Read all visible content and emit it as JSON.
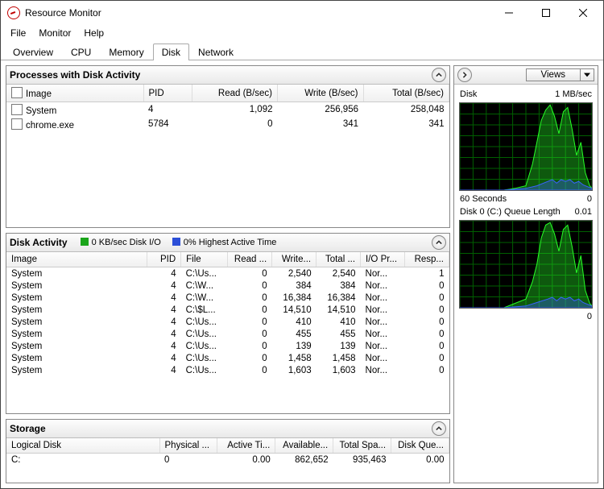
{
  "window": {
    "title": "Resource Monitor"
  },
  "menu": {
    "file": "File",
    "monitor": "Monitor",
    "help": "Help"
  },
  "tabs": {
    "items": [
      {
        "label": "Overview"
      },
      {
        "label": "CPU"
      },
      {
        "label": "Memory"
      },
      {
        "label": "Disk"
      },
      {
        "label": "Network"
      }
    ],
    "active": 3
  },
  "panels": {
    "processes": {
      "title": "Processes with Disk Activity",
      "cols": {
        "image": "Image",
        "pid": "PID",
        "read": "Read (B/sec)",
        "write": "Write (B/sec)",
        "total": "Total (B/sec)"
      },
      "rows": [
        {
          "image": "System",
          "pid": "4",
          "read": "1,092",
          "write": "256,956",
          "total": "258,048"
        },
        {
          "image": "chrome.exe",
          "pid": "5784",
          "read": "0",
          "write": "341",
          "total": "341"
        }
      ]
    },
    "activity": {
      "title": "Disk Activity",
      "meta1_label": "0 KB/sec Disk I/O",
      "meta2_label": "0% Highest Active Time",
      "cols": {
        "image": "Image",
        "pid": "PID",
        "file": "File",
        "read": "Read ...",
        "write": "Write...",
        "total": "Total ...",
        "prio": "I/O Pr...",
        "resp": "Resp..."
      },
      "rows": [
        {
          "image": "System",
          "pid": "4",
          "file": "C:\\Us...",
          "read": "0",
          "write": "2,540",
          "total": "2,540",
          "prio": "Nor...",
          "resp": "1"
        },
        {
          "image": "System",
          "pid": "4",
          "file": "C:\\W...",
          "read": "0",
          "write": "384",
          "total": "384",
          "prio": "Nor...",
          "resp": "0"
        },
        {
          "image": "System",
          "pid": "4",
          "file": "C:\\W...",
          "read": "0",
          "write": "16,384",
          "total": "16,384",
          "prio": "Nor...",
          "resp": "0"
        },
        {
          "image": "System",
          "pid": "4",
          "file": "C:\\$L...",
          "read": "0",
          "write": "14,510",
          "total": "14,510",
          "prio": "Nor...",
          "resp": "0"
        },
        {
          "image": "System",
          "pid": "4",
          "file": "C:\\Us...",
          "read": "0",
          "write": "410",
          "total": "410",
          "prio": "Nor...",
          "resp": "0"
        },
        {
          "image": "System",
          "pid": "4",
          "file": "C:\\Us...",
          "read": "0",
          "write": "455",
          "total": "455",
          "prio": "Nor...",
          "resp": "0"
        },
        {
          "image": "System",
          "pid": "4",
          "file": "C:\\Us...",
          "read": "0",
          "write": "139",
          "total": "139",
          "prio": "Nor...",
          "resp": "0"
        },
        {
          "image": "System",
          "pid": "4",
          "file": "C:\\Us...",
          "read": "0",
          "write": "1,458",
          "total": "1,458",
          "prio": "Nor...",
          "resp": "0"
        },
        {
          "image": "System",
          "pid": "4",
          "file": "C:\\Us...",
          "read": "0",
          "write": "1,603",
          "total": "1,603",
          "prio": "Nor...",
          "resp": "0"
        }
      ]
    },
    "storage": {
      "title": "Storage",
      "cols": {
        "disk": "Logical Disk",
        "phys": "Physical ...",
        "active": "Active Ti...",
        "avail": "Available...",
        "total": "Total Spa...",
        "queue": "Disk Que..."
      },
      "rows": [
        {
          "disk": "C:",
          "phys": "0",
          "active": "0.00",
          "avail": "862,652",
          "total": "935,463",
          "queue": "0.00"
        }
      ]
    }
  },
  "sidebar": {
    "views": "Views",
    "g1": {
      "title": "Disk",
      "scale": "1 MB/sec",
      "xlabel": "60 Seconds",
      "xright": "0"
    },
    "g2": {
      "title": "Disk 0 (C:) Queue Length",
      "scale": "0.01",
      "xright": "0"
    }
  },
  "chart_data": [
    {
      "type": "area",
      "title": "Disk",
      "ylabel": "MB/sec",
      "ylim": [
        0,
        1
      ],
      "xlabel": "Seconds",
      "xlim": [
        60,
        0
      ],
      "series": [
        {
          "name": "Disk I/O (green)",
          "color": "#27ff27",
          "x": [
            60,
            55,
            50,
            45,
            40,
            35,
            30,
            27,
            25,
            23,
            21,
            19,
            17,
            15,
            13,
            11,
            9,
            7,
            5,
            3,
            1,
            0
          ],
          "y": [
            0.0,
            0.0,
            0.0,
            0.0,
            0.0,
            0.02,
            0.05,
            0.3,
            0.55,
            0.8,
            0.92,
            0.98,
            0.85,
            0.65,
            0.9,
            0.95,
            0.7,
            0.4,
            0.55,
            0.2,
            0.05,
            0.02
          ]
        },
        {
          "name": "Highest Active Time (blue)",
          "color": "#3a62ff",
          "x": [
            60,
            50,
            40,
            30,
            25,
            20,
            18,
            16,
            14,
            12,
            10,
            8,
            6,
            4,
            2,
            0
          ],
          "y": [
            0.0,
            0.0,
            0.0,
            0.02,
            0.05,
            0.1,
            0.12,
            0.08,
            0.12,
            0.1,
            0.12,
            0.08,
            0.1,
            0.06,
            0.04,
            0.02
          ]
        }
      ]
    },
    {
      "type": "area",
      "title": "Disk 0 (C:) Queue Length",
      "ylabel": "Queue Length",
      "ylim": [
        0,
        0.01
      ],
      "xlabel": "Seconds",
      "xlim": [
        60,
        0
      ],
      "series": [
        {
          "name": "Queue Length (green)",
          "color": "#27ff27",
          "x": [
            60,
            55,
            50,
            45,
            40,
            35,
            30,
            27,
            25,
            23,
            21,
            19,
            17,
            15,
            13,
            11,
            9,
            7,
            5,
            3,
            1,
            0
          ],
          "y": [
            0,
            0,
            0,
            0,
            0,
            0.0005,
            0.001,
            0.003,
            0.005,
            0.008,
            0.0095,
            0.0098,
            0.0085,
            0.0065,
            0.009,
            0.0095,
            0.007,
            0.004,
            0.006,
            0.002,
            0.0005,
            0.0002
          ]
        },
        {
          "name": "(blue)",
          "color": "#3a62ff",
          "x": [
            60,
            50,
            40,
            30,
            25,
            20,
            18,
            16,
            14,
            12,
            10,
            8,
            6,
            4,
            2,
            0
          ],
          "y": [
            0,
            0,
            0,
            0.0002,
            0.0006,
            0.001,
            0.0012,
            0.0008,
            0.0012,
            0.001,
            0.0012,
            0.0008,
            0.001,
            0.0006,
            0.0004,
            0.0002
          ]
        }
      ]
    }
  ]
}
